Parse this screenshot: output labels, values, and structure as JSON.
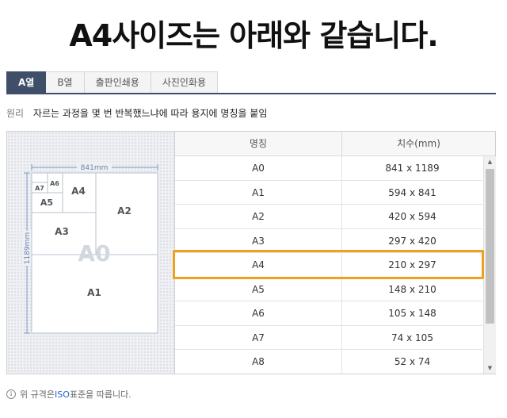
{
  "headline": "A4사이즈는 아래와 같습니다.",
  "tabs": [
    {
      "label": "A열",
      "active": true
    },
    {
      "label": "B열",
      "active": false
    },
    {
      "label": "출판인쇄용",
      "active": false
    },
    {
      "label": "사진인화용",
      "active": false
    }
  ],
  "principle": {
    "label": "원리",
    "text": "자르는 과정을 몇 번 반복했느냐에 따라 용지에 명칭을 붙임"
  },
  "diagram": {
    "width_label": "841mm",
    "height_label": "1189mm",
    "labels": {
      "a0": "A0",
      "a1": "A1",
      "a2": "A2",
      "a3": "A3",
      "a4": "A4",
      "a5": "A5",
      "a6": "A6",
      "a7": "A7"
    }
  },
  "table": {
    "headers": {
      "name": "명칭",
      "size": "치수(mm)"
    },
    "rows": [
      {
        "name": "A0",
        "size": "841 x 1189"
      },
      {
        "name": "A1",
        "size": "594 x 841"
      },
      {
        "name": "A2",
        "size": "420 x 594"
      },
      {
        "name": "A3",
        "size": "297 x 420"
      },
      {
        "name": "A4",
        "size": "210 x 297"
      },
      {
        "name": "A5",
        "size": "148 x 210"
      },
      {
        "name": "A6",
        "size": "105 x 148"
      },
      {
        "name": "A7",
        "size": "74 x 105"
      },
      {
        "name": "A8",
        "size": "52 x 74"
      }
    ],
    "highlighted_row": "A4"
  },
  "footnote": {
    "prefix": "위 규격은 ",
    "iso": "ISO",
    "suffix": " 표준을 따릅니다."
  },
  "colors": {
    "active_tab": "#3f4f6a",
    "highlight": "#f0a020",
    "iso_link": "#2a5bd7"
  }
}
